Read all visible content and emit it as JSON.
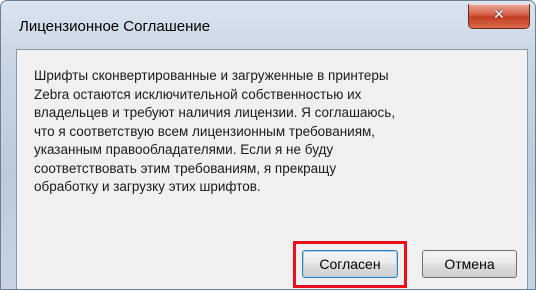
{
  "window": {
    "title": "Лицензионное Соглашение",
    "close_glyph": "✕"
  },
  "message": {
    "lines": [
      "Шрифты сконвертированные и загруженные в принтеры",
      "Zebra остаются исключительной собственностью их",
      "владельцев и требуют наличия лицензии. Я соглашаюсь,",
      "что я соответствую всем лицензионным требованиям,",
      "указанным правообладателями. Если я не буду",
      "соответствовать этим требованиям, я прекращу",
      "обработку и загрузку этих шрифтов."
    ]
  },
  "buttons": {
    "agree_label": "Согласен",
    "cancel_label": "Отмена"
  },
  "colors": {
    "highlight": "#e8101a",
    "close_button": "#c23e22"
  }
}
